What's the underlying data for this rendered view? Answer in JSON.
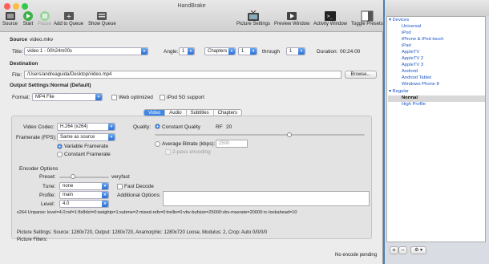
{
  "window": {
    "title": "HandBrake"
  },
  "toolbar": {
    "source": "Source",
    "start": "Start",
    "pause": "Pause",
    "add_queue": "Add to Queue",
    "show_queue": "Show Queue",
    "picture_settings": "Picture Settings",
    "preview_window": "Preview Window",
    "activity_window": "Activity Window",
    "toggle_presets": "Toggle Presets"
  },
  "source": {
    "label": "Source",
    "value": "video.mkv",
    "title_label": "Title:",
    "title_value": "video 1 - 00h24m00s",
    "angle_label": "Angle:",
    "angle_value": "1",
    "chapters_value": "Chapters",
    "from_value": "1",
    "through_label": "through",
    "through_value": "1",
    "duration_label": "Duration:",
    "duration_value": "00:24:00"
  },
  "destination": {
    "header": "Destination",
    "file_label": "File:",
    "file_value": "/Users/andreaguida/Desktop/video.mp4",
    "browse": "Browse..."
  },
  "output": {
    "header": "Output Settings:",
    "preset": "Normal (Default)",
    "format_label": "Format:",
    "format_value": "MP4 File",
    "web_optimized": "Web optimized",
    "ipod": "iPod 5G support"
  },
  "tabs": [
    "Video",
    "Audio",
    "Subtitles",
    "Chapters"
  ],
  "video": {
    "codec_label": "Video Codec:",
    "codec_value": "H.264 (x264)",
    "framerate_label": "Framerate (FPS):",
    "framerate_value": "Same as source",
    "variable": "Variable Framerate",
    "constant": "Constant Framerate",
    "quality_label": "Quality:",
    "constant_quality": "Constant Quality",
    "rf_label": "RF",
    "rf_value": "20",
    "avg_bitrate": "Average Bitrate (kbps):",
    "bitrate_value": "2500",
    "two_pass": "2-pass encoding"
  },
  "encoder": {
    "header": "Encoder Options",
    "preset_label": "Preset:",
    "preset_value": "veryfast",
    "tune_label": "Tune:",
    "tune_value": "none",
    "fast_decode": "Fast Decode",
    "profile_label": "Profile:",
    "profile_value": "main",
    "additional_label": "Additional Options:",
    "level_label": "Level:",
    "level_value": "4.0",
    "unparse": "x264 Unparse: level=4.0:ref=1:8x8dct=0:weightp=1:subme=2:mixed-refs=0:trellis=0:vbv-bufsize=25000:vbv-maxrate=20000:rc-lookahead=10"
  },
  "footer": {
    "picture_settings": "Picture Settings: Source: 1280x720, Output: 1280x720, Anamorphic: 1280x720 Loose, Modulus: 2, Crop: Auto 0/0/0/0",
    "picture_filters": "Picture Filters:",
    "status": "No encode pending"
  },
  "presets": {
    "devices_header": "Devices",
    "devices": [
      "Universal",
      "iPod",
      "iPhone & iPod touch",
      "iPad",
      "AppleTV",
      "AppleTV 2",
      "AppleTV 3",
      "Android",
      "Android Tablet",
      "Windows Phone 8"
    ],
    "regular_header": "Regular",
    "regular": [
      "Normal",
      "High Profile"
    ],
    "add": "+",
    "remove": "−",
    "gear": "⚙ ▾"
  },
  "colors": {
    "accent": "#3b86e8",
    "preset_text": "#1a55c8"
  }
}
